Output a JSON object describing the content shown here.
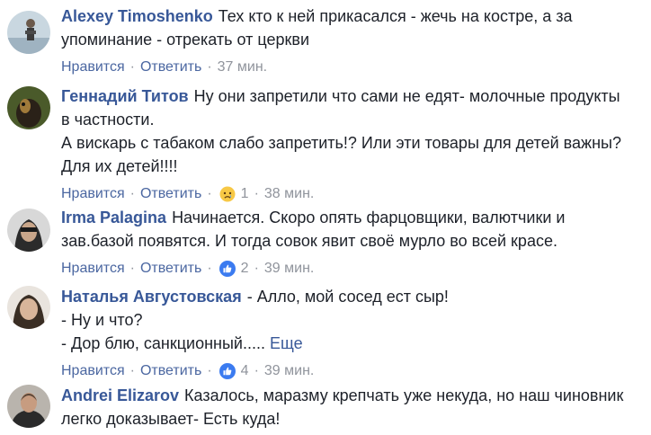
{
  "comments": [
    {
      "author": "Alexey Timoshenko",
      "lines": [
        "Тех кто к ней прикасался - жечь на костре, а за",
        "упоминание - отрекать от церкви"
      ],
      "like": "Нравится",
      "reply": "Ответить",
      "time": "37 мин."
    },
    {
      "author": "Геннадий Титов",
      "lines": [
        "Ну они запретили что сами не едят- молочные продукты",
        "в частности.",
        "А вискарь с табаком слабо запретить!? Или эти товары для детей важны?",
        "Для их детей!!!!"
      ],
      "like": "Нравится",
      "reply": "Ответить",
      "reaction_icon": "sad-reaction-icon",
      "reaction_count": "1",
      "time": "38 мин."
    },
    {
      "author": "Irma Palagina",
      "lines": [
        "Начинается. Скоро опять фарцовщики, валютчики и",
        "зав.базой появятся. И тогда совок явит своё мурло во всей красе."
      ],
      "like": "Нравится",
      "reply": "Ответить",
      "reaction_icon": "like-reaction-icon",
      "reaction_count": "2",
      "time": "39 мин."
    },
    {
      "author": "Наталья Августовская",
      "lines": [
        "- Алло, мой сосед ест сыр!",
        "- Ну и что?",
        "- Дор блю, санкционный....."
      ],
      "more": "Еще",
      "like": "Нравится",
      "reply": "Ответить",
      "reaction_icon": "like-reaction-icon",
      "reaction_count": "4",
      "time": "39 мин."
    },
    {
      "author": "Andrei Elizarov",
      "lines": [
        "Казалось, маразму крепчать уже некуда, но наш чиновник",
        "легко доказывает- Есть куда!"
      ]
    }
  ],
  "colors": {
    "author": "#385898",
    "action_link": "#4b67a1",
    "meta": "#90949c",
    "like_blue": "#3b7bf0",
    "sad_yellow": "#f7c845"
  }
}
